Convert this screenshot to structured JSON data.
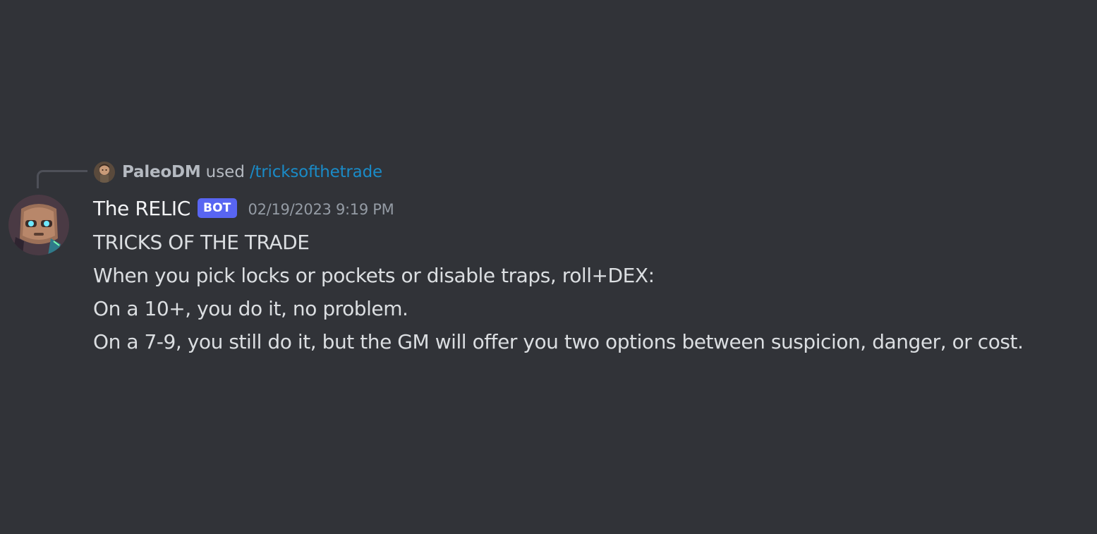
{
  "reply": {
    "author": "PaleoDM",
    "used_text": "used",
    "command": "/tricksofthetrade"
  },
  "message": {
    "author": "The RELIC",
    "bot_tag": "BOT",
    "timestamp": "02/19/2023 9:19 PM",
    "lines": [
      "TRICKS OF THE TRADE",
      "When you pick locks or pockets or disable traps, roll+DEX:",
      "On a 10+, you do it, no problem.",
      "On a 7-9, you still do it, but the GM will offer you two options between suspicion, danger, or cost."
    ]
  },
  "colors": {
    "background": "#313338",
    "command_link": "#1a8bc7",
    "bot_tag": "#5865f2"
  }
}
